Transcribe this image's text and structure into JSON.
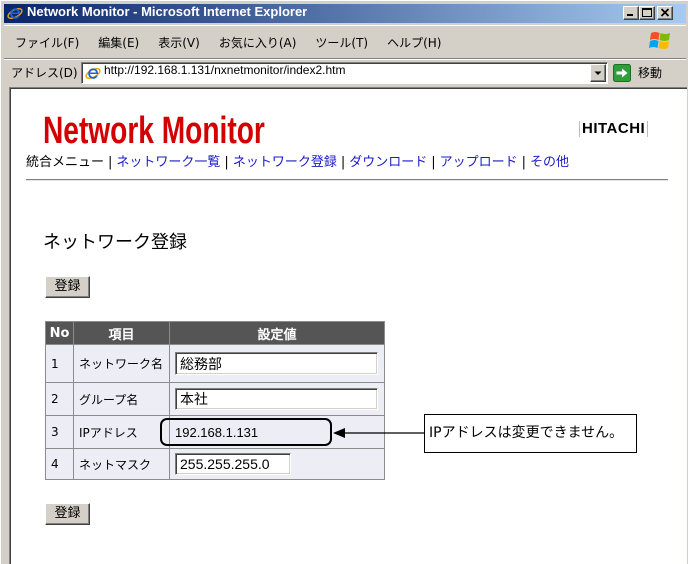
{
  "window": {
    "title": "Network Monitor - Microsoft Internet Explorer",
    "icons": {
      "app": "ie-icon",
      "minimize": "minimize-icon",
      "maximize": "maximize-icon",
      "close": "close-icon"
    }
  },
  "menubar": {
    "items": [
      "ファイル(F)",
      "編集(E)",
      "表示(V)",
      "お気に入り(A)",
      "ツール(T)",
      "ヘルプ(H)"
    ],
    "logo_icon": "windows-logo-icon"
  },
  "addressbar": {
    "label": "アドレス(D)",
    "url": "http://192.168.1.131/nxnetmonitor/index2.htm",
    "page_icon": "ie-page-icon",
    "dropdown_icon": "chevron-down-icon",
    "go_icon": "go-arrow-icon",
    "go_label": "移動"
  },
  "page": {
    "brand_title": "Network Monitor",
    "brand_logo": "HITACHI",
    "nav_separator": "|",
    "nav": [
      "統合メニュー",
      "ネットワーク一覧",
      "ネットワーク登録",
      "ダウンロード",
      "アップロード",
      "その他"
    ],
    "heading": "ネットワーク登録",
    "submit_label": "登録",
    "table": {
      "headers": [
        "No",
        "項目",
        "設定値"
      ],
      "rows": [
        {
          "no": "1",
          "item": "ネットワーク名",
          "value": "総務部",
          "editable": true
        },
        {
          "no": "2",
          "item": "グループ名",
          "value": "本社",
          "editable": true
        },
        {
          "no": "3",
          "item": "IPアドレス",
          "value": "192.168.1.131",
          "editable": false
        },
        {
          "no": "4",
          "item": "ネットマスク",
          "value": "255.255.255.0",
          "editable": true
        }
      ]
    }
  },
  "annotation": {
    "text": "IPアドレスは変更できません。"
  },
  "colors": {
    "chrome": "#D4D0C8",
    "titlebar_start": "#0A246A",
    "titlebar_end": "#A6CAF0",
    "brand_red": "#D40000",
    "link_blue": "#1A1AC8",
    "table_header": "#555555",
    "table_cell": "#EDEDF5"
  }
}
